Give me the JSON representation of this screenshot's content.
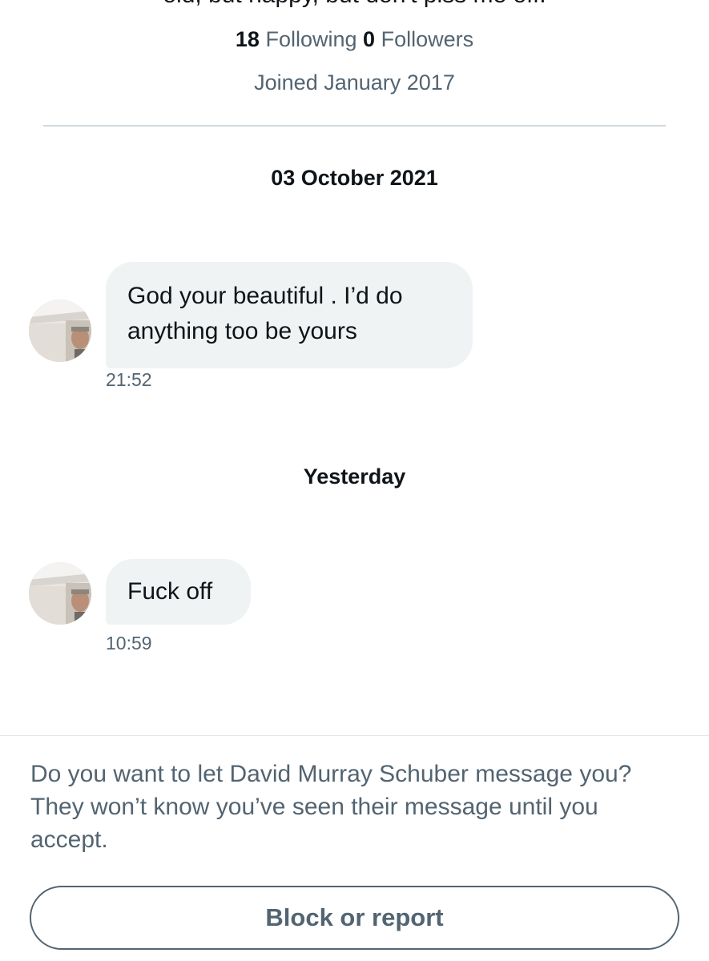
{
  "profile": {
    "bio_cutoff": "old, but happy, but don't piss me off.",
    "following_count": "18",
    "following_label": "Following",
    "followers_count": "0",
    "followers_label": "Followers",
    "joined": "Joined January 2017"
  },
  "conversation": {
    "groups": [
      {
        "date": "03 October 2021",
        "message": {
          "lines": [
            "God your beautiful . I’d do",
            "anything too be yours"
          ],
          "time": "21:52"
        }
      },
      {
        "date": "Yesterday",
        "message": {
          "lines": [
            "Fuck off"
          ],
          "time": "10:59"
        }
      }
    ]
  },
  "request": {
    "prompt": "Do you want to let David Murray Schuber message you? They won’t know you’ve seen their message until you accept.",
    "block_label": "Block or report"
  },
  "colors": {
    "text_primary": "#0f1419",
    "text_secondary": "#536471",
    "bubble_bg": "#eff3f4",
    "divider": "#cfd9de"
  }
}
